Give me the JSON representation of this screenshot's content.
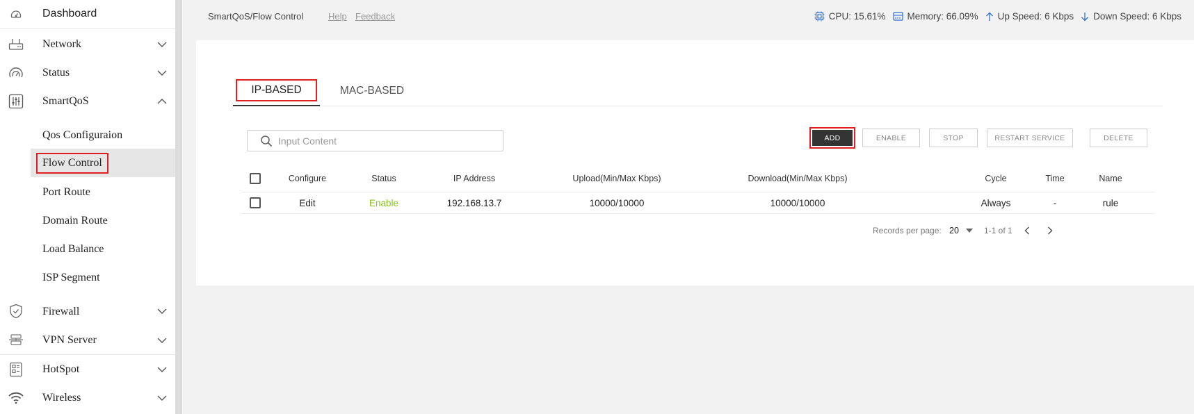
{
  "sidebar": {
    "dashboard": "Dashboard",
    "network": "Network",
    "status": "Status",
    "smartqos": "SmartQoS",
    "qos_configuration": "Qos Configuraion",
    "flow_control": "Flow Control",
    "port_route": "Port Route",
    "domain_route": "Domain Route",
    "load_balance": "Load Balance",
    "isp_segment": "ISP Segment",
    "firewall": "Firewall",
    "vpn_server": "VPN Server",
    "hotspot": "HotSpot",
    "wireless": "Wireless"
  },
  "topbar": {
    "breadcrumb": "SmartQoS/Flow Control",
    "help": "Help",
    "feedback": "Feedback",
    "cpu": "CPU: 15.61%",
    "memory": "Memory: 66.09%",
    "up_speed": "Up Speed: 6 Kbps",
    "down_speed": "Down Speed: 6 Kbps"
  },
  "tabs": {
    "ip_based": "IP-BASED",
    "mac_based": "MAC-BASED"
  },
  "search": {
    "placeholder": "Input Content"
  },
  "buttons": {
    "add": "ADD",
    "enable": "ENABLE",
    "stop": "STOP",
    "restart": "RESTART SERVICE",
    "delete": "DELETE"
  },
  "table": {
    "headers": {
      "configure": "Configure",
      "status": "Status",
      "ip_address": "IP Address",
      "upload": "Upload(Min/Max Kbps)",
      "download": "Download(Min/Max Kbps)",
      "cycle": "Cycle",
      "time": "Time",
      "name": "Name"
    },
    "rows": [
      {
        "configure": "Edit",
        "status": "Enable",
        "ip_address": "192.168.13.7",
        "upload": "10000/10000",
        "download": "10000/10000",
        "cycle": "Always",
        "time": "-",
        "name": "rule"
      }
    ]
  },
  "pagination": {
    "records_label": "Records per page:",
    "per_page": "20",
    "range": "1-1 of 1"
  },
  "colors": {
    "accent_red": "#e02020",
    "enable_green": "#8ac11b",
    "add_button_bg": "#333333"
  }
}
